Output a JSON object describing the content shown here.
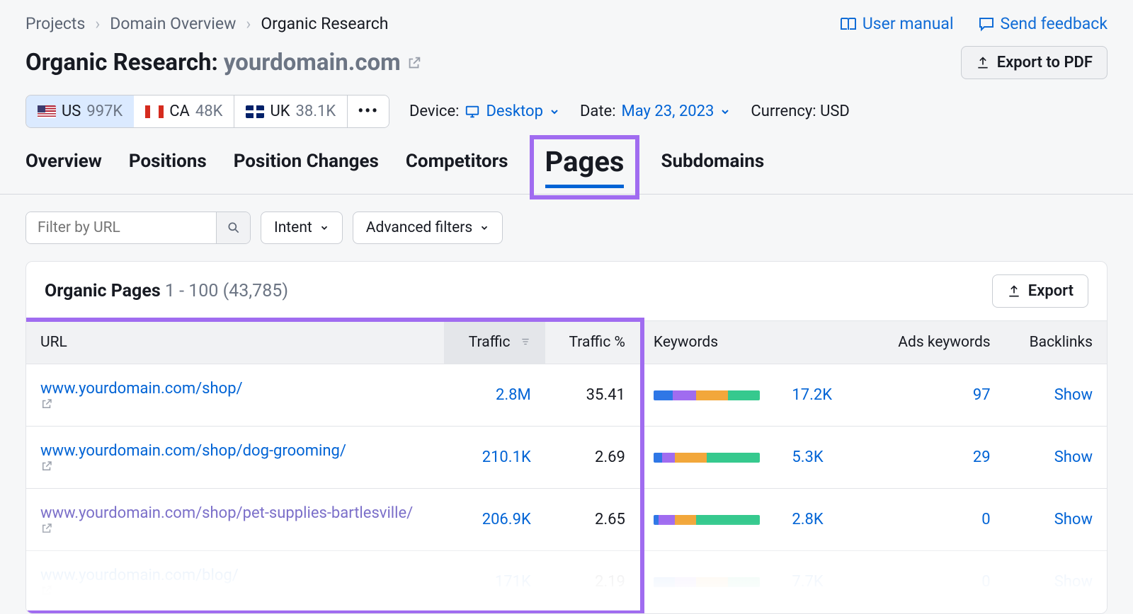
{
  "breadcrumbs": {
    "items": [
      "Projects",
      "Domain Overview",
      "Organic Research"
    ]
  },
  "toplinks": {
    "manual": "User manual",
    "feedback": "Send feedback"
  },
  "title": {
    "prefix": "Organic Research: ",
    "domain": "yourdomain.com"
  },
  "export_pdf": "Export to PDF",
  "countries": {
    "us": {
      "code": "US",
      "count": "997K"
    },
    "ca": {
      "code": "CA",
      "count": "48K"
    },
    "uk": {
      "code": "UK",
      "count": "38.1K"
    }
  },
  "device": {
    "label": "Device:",
    "value": "Desktop"
  },
  "date": {
    "label": "Date:",
    "value": "May 23, 2023"
  },
  "currency": {
    "label": "Currency: USD"
  },
  "tabs": {
    "overview": "Overview",
    "positions": "Positions",
    "position_changes": "Position Changes",
    "competitors": "Competitors",
    "pages": "Pages",
    "subdomains": "Subdomains"
  },
  "filters": {
    "url_placeholder": "Filter by URL",
    "intent": "Intent",
    "advanced": "Advanced filters"
  },
  "section": {
    "title": "Organic Pages",
    "range": "1 - 100 (43,785)",
    "export": "Export"
  },
  "columns": {
    "url": "URL",
    "traffic": "Traffic",
    "traffic_pct": "Traffic %",
    "keywords": "Keywords",
    "ads_keywords": "Ads keywords",
    "backlinks": "Backlinks"
  },
  "rows": [
    {
      "url": "www.yourdomain.com/shop/",
      "traffic": "2.8M",
      "traffic_pct": "35.41",
      "kw": [
        18,
        22,
        30,
        30
      ],
      "keywords": "17.2K",
      "ads": "97",
      "backlinks": "Show"
    },
    {
      "url": "www.yourdomain.com/shop/dog-grooming/",
      "traffic": "210.1K",
      "traffic_pct": "2.69",
      "kw": [
        8,
        12,
        30,
        50
      ],
      "keywords": "5.3K",
      "ads": "29",
      "backlinks": "Show"
    },
    {
      "url": "www.yourdomain.com/shop/pet-supplies-bartlesville/",
      "traffic": "206.9K",
      "traffic_pct": "2.65",
      "kw": [
        5,
        15,
        20,
        60
      ],
      "keywords": "2.8K",
      "ads": "0",
      "backlinks": "Show",
      "visited": true
    },
    {
      "url": "www.yourdomain.com/blog/",
      "traffic": "171K",
      "traffic_pct": "2.19",
      "kw": [
        20,
        20,
        30,
        30
      ],
      "keywords": "7.7K",
      "ads": "0",
      "backlinks": "Show",
      "faded": true
    }
  ]
}
